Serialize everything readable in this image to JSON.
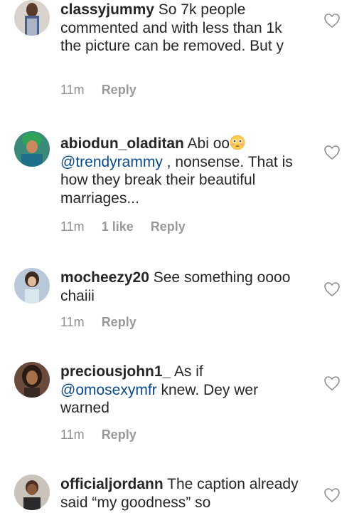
{
  "comments": [
    {
      "username": "classyjummy",
      "text": " So 7k people commented and with less than 1k the picture can be removed. But y",
      "time": "11m",
      "likes": "",
      "reply": "Reply"
    },
    {
      "username": "abiodun_oladitan",
      "text_before": " Abi oo",
      "emoji": "flushed-face-emoji",
      "mention": "@trendyrammy",
      "text_after": " , nonsense. That is how they break their beautiful marriages...",
      "time": "11m",
      "likes": "1 like",
      "reply": "Reply"
    },
    {
      "username": "mocheezy20",
      "text": " See something oooo chaiii",
      "time": "11m",
      "likes": "",
      "reply": "Reply"
    },
    {
      "username": "preciousjohn1_",
      "text_before": "  As if",
      "mention": "@omosexymfr",
      "text_after": " knew. Dey wer warned",
      "time": "11m",
      "likes": "",
      "reply": "Reply"
    },
    {
      "username": "officialjordann",
      "text": " The caption already said “my goodness” so",
      "time": "",
      "likes": "",
      "reply": ""
    }
  ],
  "colors": {
    "text": "#262626",
    "meta": "#8e8e8e",
    "mention": "#0a4a8c",
    "heart_outline": "#8e8e8e"
  }
}
